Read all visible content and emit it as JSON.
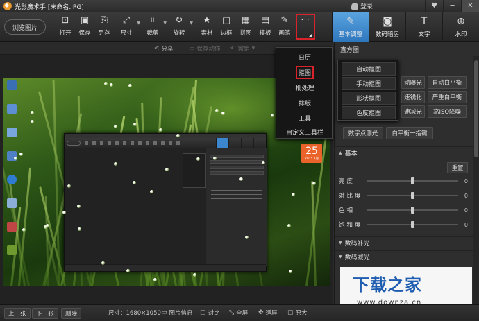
{
  "app": {
    "title": "光影魔术手 [未命名.JPG]",
    "login_label": "登录",
    "window_controls": [
      "♥",
      "─",
      "✕"
    ]
  },
  "toolbar": {
    "browse_label": "浏览图片",
    "tools": [
      {
        "label": "打开",
        "icon": "open-icon",
        "glyph": "⊡"
      },
      {
        "label": "保存",
        "icon": "save-icon",
        "glyph": "▣"
      },
      {
        "label": "另存",
        "icon": "save-as-icon",
        "glyph": "⎘"
      },
      {
        "label": "尺寸",
        "icon": "resize-icon",
        "glyph": "⤢"
      },
      {
        "label": "裁剪",
        "icon": "crop-icon",
        "glyph": "⌗"
      },
      {
        "label": "旋转",
        "icon": "rotate-icon",
        "glyph": "↻"
      },
      {
        "label": "素材",
        "icon": "material-icon",
        "glyph": "★"
      },
      {
        "label": "边框",
        "icon": "frame-icon",
        "glyph": "▢"
      },
      {
        "label": "拼图",
        "icon": "collage-icon",
        "glyph": "▦"
      },
      {
        "label": "模板",
        "icon": "template-icon",
        "glyph": "▤"
      },
      {
        "label": "画笔",
        "icon": "brush-icon",
        "glyph": "✎"
      }
    ],
    "more_glyph": "···",
    "right_tabs": [
      {
        "label": "基本调整",
        "icon": "adjust-icon",
        "glyph": "✎",
        "active": true
      },
      {
        "label": "数码暗房",
        "icon": "darkroom-icon",
        "glyph": "◙",
        "active": false
      },
      {
        "label": "文字",
        "icon": "text-icon",
        "glyph": "T",
        "active": false
      },
      {
        "label": "水印",
        "icon": "watermark-icon",
        "glyph": "⊕",
        "active": false
      }
    ]
  },
  "subbar": {
    "share": "分享",
    "save_action": "保存动作",
    "undo": "撤销"
  },
  "dropdown": {
    "items": [
      "日历",
      "抠图",
      "批处理",
      "排版",
      "工具",
      "自定义工具栏"
    ],
    "highlighted": "抠图"
  },
  "submenu": {
    "items": [
      "自动抠图",
      "手动抠图",
      "形状抠图",
      "色度抠图"
    ]
  },
  "panel": {
    "header": "直方图",
    "buttons": [
      "动曝光",
      "自动白平衡",
      "速锐化",
      "严重白平衡",
      "速减光",
      "高ISO降噪",
      "数字点测光",
      "白平衡一指键"
    ],
    "basic_section": "基本",
    "reset_label": "重置",
    "sliders": [
      {
        "label": "亮度",
        "value": "0",
        "level": 0.5
      },
      {
        "label": "对比度",
        "value": "0",
        "level": 0.5
      },
      {
        "label": "色相",
        "value": "0",
        "level": 0.5
      },
      {
        "label": "饱和度",
        "value": "0",
        "level": 0.5
      }
    ],
    "sections": [
      "数码补光",
      "数码减光"
    ]
  },
  "desktop": {
    "calendar_day": "25",
    "calendar_month": "2015.7月"
  },
  "statusbar": {
    "prev": "上一张",
    "next": "下一张",
    "delete": "删除",
    "size": "尺寸：1680×1050",
    "info": "图片信息",
    "compare": "对比",
    "fullscreen": "全屏",
    "fit": "适屏",
    "original": "原大"
  },
  "watermark": {
    "text": "下载之家",
    "url": "www.downza.cn"
  },
  "colors": {
    "accent": "#3b86cc",
    "highlight_border": "#d8232a"
  }
}
